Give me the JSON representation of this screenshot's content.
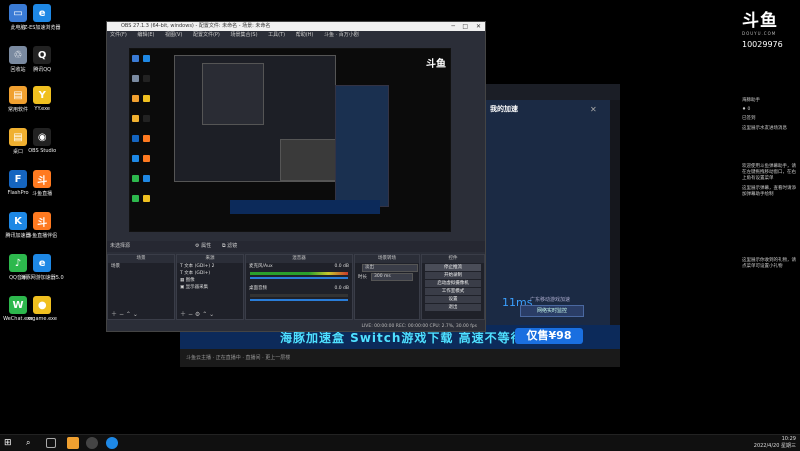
{
  "desktop_icons": [
    {
      "label": "此电脑",
      "color": "#3a7bd5",
      "glyph": "▭"
    },
    {
      "label": "Z-ES加速浏览器",
      "color": "#1e88e5",
      "glyph": "e"
    },
    {
      "label": "回收站",
      "color": "#7a8aa0",
      "glyph": "♲"
    },
    {
      "label": "腾讯QQ",
      "color": "#222",
      "glyph": "Q"
    },
    {
      "label": "常用软件",
      "color": "#f0a030",
      "glyph": "▤"
    },
    {
      "label": "YY.exe",
      "color": "#f0c020",
      "glyph": "Y"
    },
    {
      "label": "桌口",
      "color": "#f0b030",
      "glyph": "▤"
    },
    {
      "label": "OBS Studio",
      "color": "#222",
      "glyph": "◉"
    },
    {
      "label": "FlashPro",
      "color": "#1565c0",
      "glyph": "F"
    },
    {
      "label": "斗鱼直播",
      "color": "#ff7a20",
      "glyph": "斗"
    },
    {
      "label": "腾讯加速器",
      "color": "#1e88e5",
      "glyph": "K"
    },
    {
      "label": "斗鱼直播伴侣",
      "color": "#ff7a20",
      "glyph": "斗"
    },
    {
      "label": "QQ音乐",
      "color": "#2db84d",
      "glyph": "♪"
    },
    {
      "label": "海豚网游加速器5.0",
      "color": "#1e88e5",
      "glyph": "e"
    },
    {
      "label": "WeChat.exe",
      "color": "#2db84d",
      "glyph": "W"
    },
    {
      "label": "mgame.exe",
      "color": "#f0c020",
      "glyph": "●"
    }
  ],
  "douyu": {
    "logo": "斗鱼",
    "sub": "DOUYU.COM",
    "room_id": "10029976"
  },
  "chat": [
    "海豚助手",
    "♦  0",
    "已签到",
    "这里展示水友进场消息",
    "欢迎使用斗鱼弹幕助手，请在左键拖拽移动窗口，在右上角有设置菜单",
    "这里展示弹幕，查看时请添加弹幕助手绘制",
    "这里展示你收到的礼物，请点菜单可设置小礼物"
  ],
  "accelerator": {
    "title": "我的加速",
    "latency": "11ms",
    "region": "广东移动游戏加速",
    "button": "网络实时监控"
  },
  "banner": {
    "text": "海豚加速盒  Switch游戏下载  高速不等待",
    "price": "仅售¥98"
  },
  "bg_window_status": "斗鱼云主播  ·  正在直播中  ·  直播间  ·  更上一层楼",
  "obs": {
    "title": "OBS 27.1.3 (64-bit, windows) - 配置文件: 未命名 - 场景: 未命名",
    "menu": [
      "文件(F)",
      "编辑(E)",
      "视图(V)",
      "配置文件(P)",
      "场景集合(S)",
      "工具(T)",
      "帮助(H)",
      "斗鱼 · 百万小剧"
    ],
    "scene_bar": "未选择源",
    "scene_bar_right": [
      "⚙ 属性",
      "⧉ 滤镜"
    ],
    "docks": {
      "scenes": {
        "header": "场景",
        "items": [
          "场景"
        ]
      },
      "sources": {
        "header": "来源",
        "items": [
          "T  文本 (GDI+) 2",
          "T  文本 (GDI+)",
          "▦  图像",
          "▣  显示器采集"
        ]
      },
      "mixer": {
        "header": "混音器",
        "tracks": [
          {
            "name": "麦克风/Aux",
            "db": "0.0 dB"
          },
          {
            "name": "桌面音频",
            "db": "0.0 dB"
          }
        ]
      },
      "transitions": {
        "header": "场景转场",
        "mode": "淡出",
        "duration_label": "时长",
        "duration": "300 ms"
      },
      "controls": {
        "header": "控件",
        "buttons": [
          "停止推流",
          "开始录制",
          "启动虚拟摄像机",
          "工作室模式",
          "设置",
          "退出"
        ]
      }
    },
    "status": "LIVE: 00:00:00   REC: 00:00:00   CPU: 2.7%, 30.00 fps"
  },
  "taskbar": {
    "time": "10:29",
    "date": "2022/4/20 星期三"
  }
}
